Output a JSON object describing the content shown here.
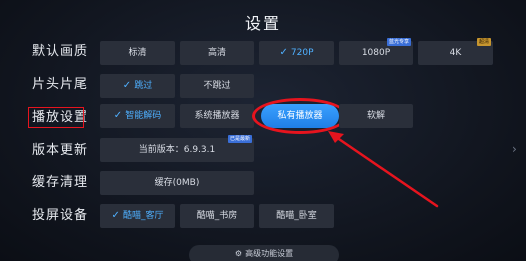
{
  "title": "设置",
  "rows": {
    "quality": {
      "label": "默认画质",
      "options": [
        "标清",
        "高清",
        "720P",
        "1080P",
        "4K"
      ],
      "selected": "720P",
      "badges": {
        "1080P": "蓝光专享",
        "4K": "超清"
      }
    },
    "skip": {
      "label": "片头片尾",
      "options": [
        "跳过",
        "不跳过"
      ],
      "selected": "跳过"
    },
    "play": {
      "label": "播放设置",
      "options": [
        "智能解码",
        "系统播放器",
        "私有播放器",
        "软解"
      ],
      "selected": "智能解码",
      "focused": "私有播放器"
    },
    "update": {
      "label": "版本更新",
      "value": "当前版本：6.9.3.1",
      "badge": "已是最新"
    },
    "cache": {
      "label": "缓存清理",
      "value": "缓存(0MB)"
    },
    "cast": {
      "label": "投屏设备",
      "options": [
        "酷喵_客厅",
        "酷喵_书房",
        "酷喵_卧室"
      ],
      "selected": "酷喵_客厅"
    }
  },
  "advanced_button": "高级功能设置",
  "icons": {
    "check": "check-icon",
    "gear": "gear-icon",
    "chevron": "chevron-right-icon"
  },
  "colors": {
    "accent": "#4fb0ff",
    "focus": "#2a8cf5",
    "annotation": "#e6141e"
  }
}
